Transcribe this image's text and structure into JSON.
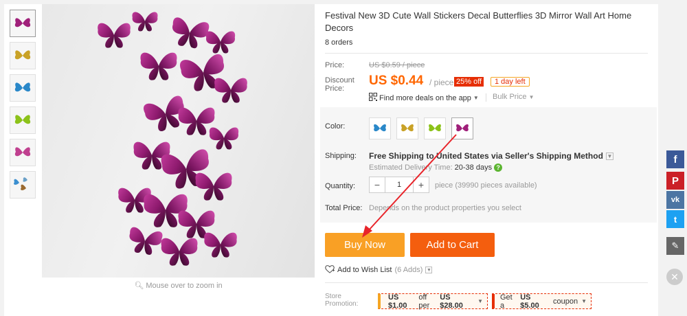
{
  "product": {
    "title": "Festival New 3D Cute Wall Stickers Decal Butterflies 3D Mirror Wall Art Home Decors",
    "orders": "8 orders",
    "zoom_hint": "Mouse over to zoom in"
  },
  "price": {
    "label": "Price:",
    "original": "US $0.59 / piece",
    "discount_label": "Discount Price:",
    "discount_price": "US $0.44",
    "unit": "/ piece",
    "off_badge": "25% off",
    "days_badge": "1 day left",
    "app_deals": "Find more deals on the app",
    "bulk_price": "Bulk Price"
  },
  "options": {
    "color_label": "Color:",
    "shipping_label": "Shipping:",
    "shipping_text": "Free Shipping to United States via Seller's Shipping Method",
    "eta_label": "Estimated Delivery Time:",
    "eta_value": "20-38 days",
    "quantity_label": "Quantity:",
    "quantity_value": "1",
    "quantity_note": "piece (39990 pieces available)",
    "total_label": "Total Price:",
    "total_note": "Depends on the product properties you select"
  },
  "actions": {
    "buy_now": "Buy Now",
    "add_to_cart": "Add to Cart",
    "wish_list": "Add to Wish List",
    "wish_count": "(6 Adds)"
  },
  "promotion": {
    "label": "Store Promotion:",
    "coupon1_prefix": "US $1.00",
    "coupon1_mid": "off per",
    "coupon1_amount": "US $28.00",
    "coupon2_prefix": "Get a",
    "coupon2_amount": "US $5.00",
    "coupon2_suffix": "coupon"
  },
  "share": {
    "facebook": "f",
    "pinterest": "P",
    "vk": "vk",
    "twitter": "t",
    "edit": "✎",
    "close": "✕"
  },
  "colors": {
    "accent_orange": "#f60",
    "buy_now": "#f9a025",
    "add_to_cart": "#f45e0e",
    "badge_red": "#e62e04",
    "butterfly_purple": "#a0207a",
    "arrow": "#e8242a"
  },
  "thumbnails": [
    "purple-butterflies",
    "gold-butterflies",
    "blue-butterflies",
    "green-butterflies",
    "pink-butterflies",
    "mixed-butterflies"
  ],
  "swatches": [
    "blue",
    "gold",
    "green",
    "purple"
  ]
}
